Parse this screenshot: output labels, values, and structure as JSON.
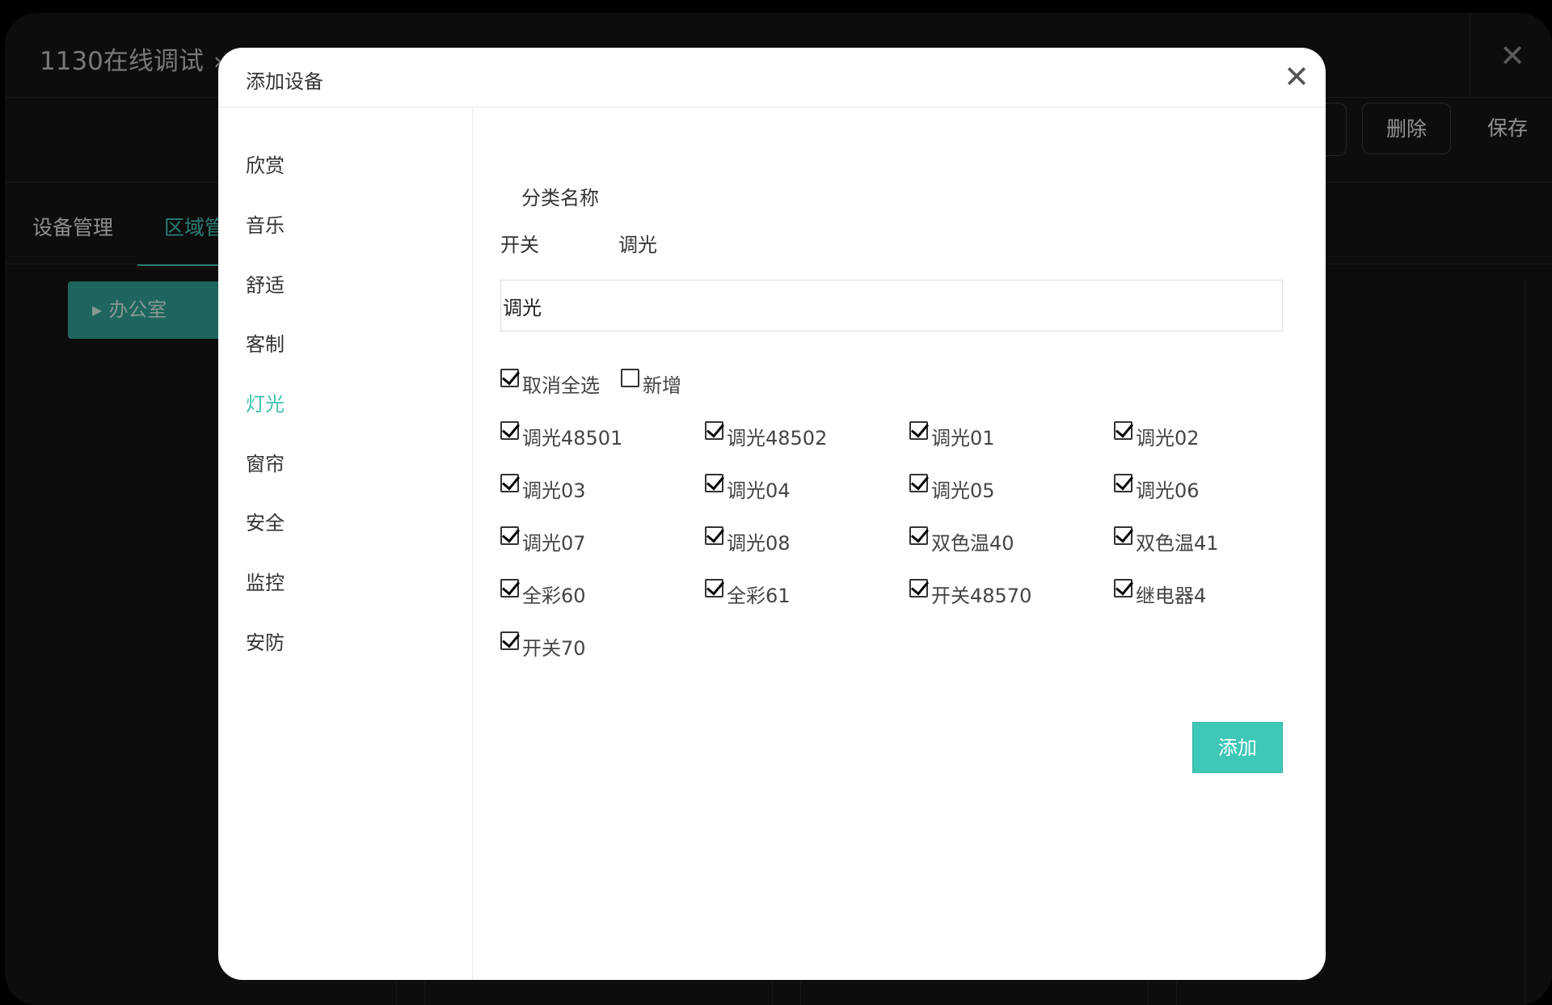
{
  "background": {
    "title": "1130在线调试",
    "title_sep": "›",
    "close_glyph": "✕",
    "delete_label": "删除",
    "save_label": "保存",
    "tabs": [
      "设备管理",
      "区域管"
    ],
    "room_label": "办公室",
    "room_caret": "▶"
  },
  "modal": {
    "title": "添加设备",
    "close_glyph": "✕",
    "sidebar": [
      {
        "label": "欣赏",
        "active": false
      },
      {
        "label": "音乐",
        "active": false
      },
      {
        "label": "舒适",
        "active": false
      },
      {
        "label": "客制",
        "active": false
      },
      {
        "label": "灯光",
        "active": true
      },
      {
        "label": "窗帘",
        "active": false
      },
      {
        "label": "安全",
        "active": false
      },
      {
        "label": "监控",
        "active": false
      },
      {
        "label": "安防",
        "active": false
      }
    ],
    "section_label": "分类名称",
    "category_tabs": [
      "开关",
      "调光"
    ],
    "name_input_value": "调光",
    "select_all": {
      "label": "取消全选",
      "checked": true
    },
    "new_item": {
      "label": "新增",
      "checked": false
    },
    "devices": [
      {
        "label": "调光48501",
        "checked": true
      },
      {
        "label": "调光48502",
        "checked": true
      },
      {
        "label": "调光01",
        "checked": true
      },
      {
        "label": "调光02",
        "checked": true
      },
      {
        "label": "调光03",
        "checked": true
      },
      {
        "label": "调光04",
        "checked": true
      },
      {
        "label": "调光05",
        "checked": true
      },
      {
        "label": "调光06",
        "checked": true
      },
      {
        "label": "调光07",
        "checked": true
      },
      {
        "label": "调光08",
        "checked": true
      },
      {
        "label": "双色温40",
        "checked": true
      },
      {
        "label": "双色温41",
        "checked": true
      },
      {
        "label": "全彩60",
        "checked": true
      },
      {
        "label": "全彩61",
        "checked": true
      },
      {
        "label": "开关48570",
        "checked": true
      },
      {
        "label": "继电器4",
        "checked": true
      },
      {
        "label": "开关70",
        "checked": true
      }
    ],
    "add_button_label": "添加"
  },
  "colors": {
    "accent": "#3fc1b0",
    "add_button": "#3fc7b7",
    "room_button": "#2d9c8f"
  }
}
